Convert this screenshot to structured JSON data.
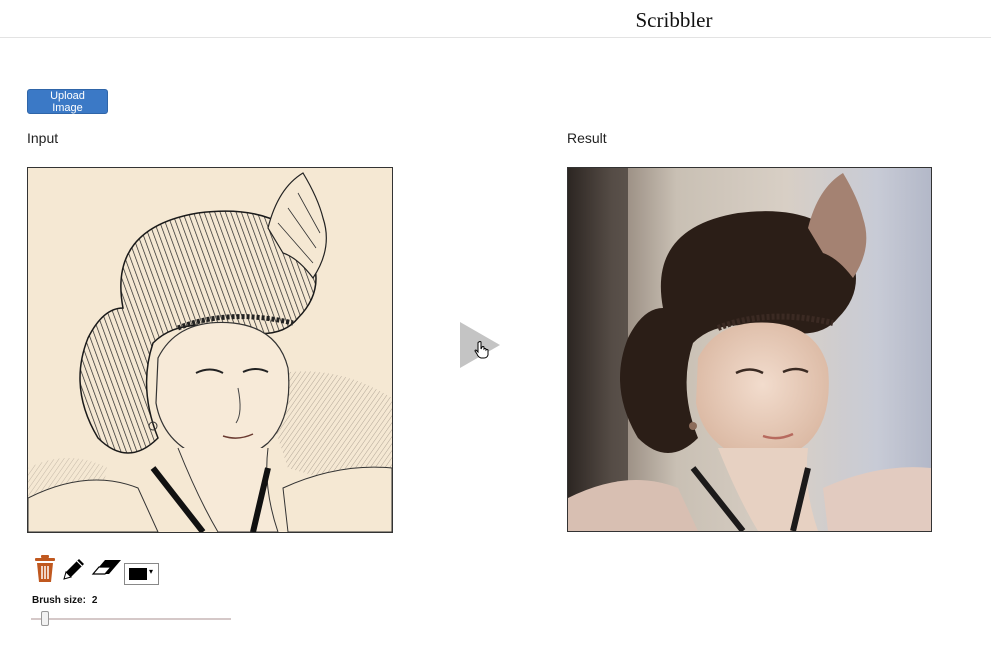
{
  "header": {
    "title": "Scribbler"
  },
  "toolbar": {
    "upload_label": "Upload Image"
  },
  "panels": {
    "input_label": "Input",
    "result_label": "Result"
  },
  "tools": {
    "trash_icon": "trash-icon",
    "pencil_icon": "pencil-icon",
    "eraser_icon": "eraser-icon",
    "color_value": "#000000",
    "color_arrow": "▾"
  },
  "brush": {
    "label": "Brush size:",
    "value": "2",
    "fraction": 0.05
  },
  "colors": {
    "accent": "#3b79c6",
    "trash": "#c0581f",
    "run_button": "#c4c4c4"
  }
}
